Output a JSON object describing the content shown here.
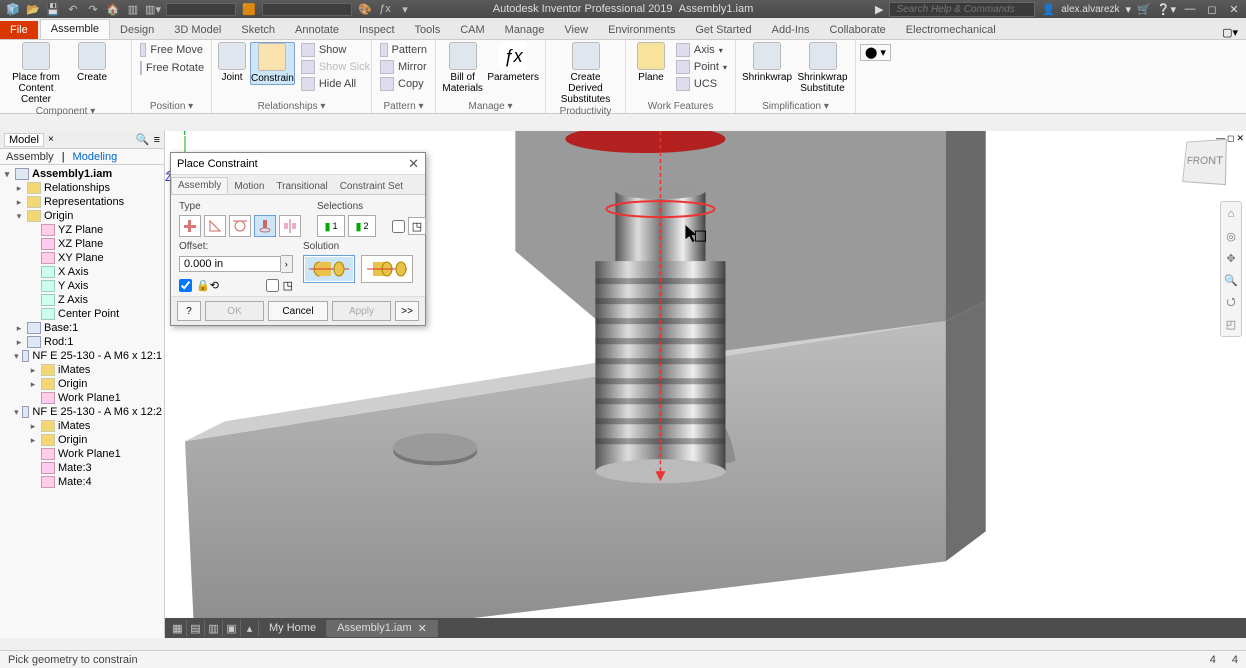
{
  "app": {
    "title": "Autodesk Inventor Professional 2019",
    "doc": "Assembly1.iam"
  },
  "user": {
    "name": "alex.alvarezk"
  },
  "search": {
    "placeholder": "Search Help & Commands"
  },
  "ribbon": {
    "file": "File",
    "tabs": [
      "Assemble",
      "Design",
      "3D Model",
      "Sketch",
      "Annotate",
      "Inspect",
      "Tools",
      "CAM",
      "Manage",
      "View",
      "Environments",
      "Get Started",
      "Add-Ins",
      "Collaborate",
      "Electromechanical"
    ],
    "active": 0,
    "groups": {
      "component": {
        "label": "Component ▾",
        "placeFrom": "Place from\nContent Center",
        "create": "Create"
      },
      "position": {
        "label": "Position ▾",
        "freeMove": "Free Move",
        "freeRotate": "Free Rotate"
      },
      "relationships": {
        "label": "Relationships ▾",
        "joint": "Joint",
        "constrain": "Constrain",
        "show": "Show",
        "showSick": "Show Sick",
        "hideAll": "Hide All"
      },
      "pattern": {
        "label": "Pattern ▾",
        "pattern": "Pattern",
        "mirror": "Mirror",
        "copy": "Copy"
      },
      "manage": {
        "label": "Manage ▾",
        "bom": "Bill of\nMaterials",
        "params": "Parameters"
      },
      "productivity": {
        "label": "Productivity",
        "derived": "Create Derived\nSubstitutes"
      },
      "workfeat": {
        "label": "Work Features",
        "plane": "Plane",
        "axis": "Axis",
        "point": "Point",
        "ucs": "UCS"
      },
      "simpl": {
        "label": "Simplification ▾",
        "shrink": "Shrinkwrap",
        "shrinkSub": "Shrinkwrap\nSubstitute"
      }
    }
  },
  "browser": {
    "panelTab": "Model",
    "modes": [
      "Assembly",
      "Modeling"
    ],
    "root": "Assembly1.iam",
    "nodes": [
      {
        "l": 1,
        "t": "Relationships",
        "exp": "▸",
        "ico": "f"
      },
      {
        "l": 1,
        "t": "Representations",
        "exp": "▸",
        "ico": "f"
      },
      {
        "l": 1,
        "t": "Origin",
        "exp": "▾",
        "ico": "f"
      },
      {
        "l": 2,
        "t": "YZ Plane",
        "ico": "plane"
      },
      {
        "l": 2,
        "t": "XZ Plane",
        "ico": "plane"
      },
      {
        "l": 2,
        "t": "XY Plane",
        "ico": "plane"
      },
      {
        "l": 2,
        "t": "X Axis",
        "ico": "axis"
      },
      {
        "l": 2,
        "t": "Y Axis",
        "ico": "axis"
      },
      {
        "l": 2,
        "t": "Z Axis",
        "ico": "axis"
      },
      {
        "l": 2,
        "t": "Center Point",
        "ico": "axis"
      },
      {
        "l": 1,
        "t": "Base:1",
        "exp": "▸",
        "ico": "part"
      },
      {
        "l": 1,
        "t": "Rod:1",
        "exp": "▸",
        "ico": "part"
      },
      {
        "l": 1,
        "t": "NF E 25-130 - A M6 x 12:1",
        "exp": "▾",
        "ico": "part"
      },
      {
        "l": 2,
        "t": "iMates",
        "exp": "▸",
        "ico": "f"
      },
      {
        "l": 2,
        "t": "Origin",
        "exp": "▸",
        "ico": "f"
      },
      {
        "l": 2,
        "t": "Work Plane1",
        "ico": "plane"
      },
      {
        "l": 1,
        "t": "NF E 25-130 - A M6 x 12:2",
        "exp": "▾",
        "ico": "part"
      },
      {
        "l": 2,
        "t": "iMates",
        "exp": "▸",
        "ico": "f"
      },
      {
        "l": 2,
        "t": "Origin",
        "exp": "▸",
        "ico": "f"
      },
      {
        "l": 2,
        "t": "Work Plane1",
        "ico": "plane"
      },
      {
        "l": 2,
        "t": "Mate:3",
        "ico": "plane"
      },
      {
        "l": 2,
        "t": "Mate:4",
        "ico": "plane"
      }
    ]
  },
  "dialog": {
    "title": "Place Constraint",
    "tabs": [
      "Assembly",
      "Motion",
      "Transitional",
      "Constraint Set"
    ],
    "activeTab": 0,
    "typeLabel": "Type",
    "selLabel": "Selections",
    "sel1": "1",
    "sel2": "2",
    "offsetLabel": "Offset:",
    "offsetVal": "0.000 in",
    "solutionLabel": "Solution",
    "ok": "OK",
    "cancel": "Cancel",
    "apply": "Apply",
    "expand": ">>"
  },
  "viewcube": {
    "face": "FRONT"
  },
  "doctabs": {
    "home": "My Home",
    "doc": "Assembly1.iam"
  },
  "status": {
    "msg": "Pick geometry to constrain",
    "n1": "4",
    "n2": "4"
  }
}
